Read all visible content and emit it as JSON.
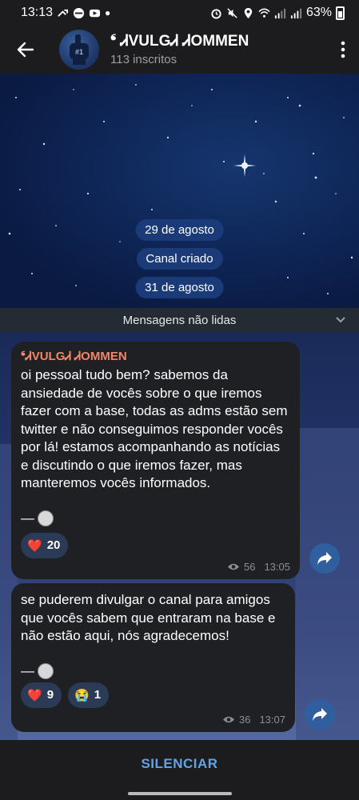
{
  "status_bar": {
    "time": "13:13",
    "battery": "63%"
  },
  "header": {
    "title": "⁶ ᏗVulgᏗ ᏗOMMEN",
    "title_display": "❛ ᏗVULGᏗ ᏗOMMEN",
    "subscribers": "113 inscritos",
    "avatar_text": "#1"
  },
  "timeline": {
    "date1": "29 de agosto",
    "channel_created": "Canal criado",
    "date2": "31 de agosto",
    "unread": "Mensagens não lidas"
  },
  "messages": [
    {
      "author": "❛ᏗVULGᏗ ᏗOMMEN",
      "text": "oi pessoal tudo bem? sabemos da ansiedade de vocês sobre o que iremos fazer com a base, todas as adms estão sem twitter e não conseguimos responder vocês por lá! estamos acompanhando as notícias e discutindo o que iremos fazer, mas manteremos vocês informados.",
      "signature": "—",
      "reactions": [
        {
          "emoji": "❤️",
          "count": "20"
        }
      ],
      "views": "56",
      "time": "13:05"
    },
    {
      "text": "se puderem divulgar o canal para amigos que vocês sabem que entraram na base e não estão aqui, nós agradecemos!",
      "signature": "—",
      "reactions": [
        {
          "emoji": "❤️",
          "count": "9"
        },
        {
          "emoji": "😭",
          "count": "1"
        }
      ],
      "views": "36",
      "time": "13:07"
    }
  ],
  "bottom": {
    "mute_label": "SILENCIAR"
  },
  "colors": {
    "accent": "#62a3e6",
    "author": "#f0876b",
    "bubble": "#1e2024"
  }
}
